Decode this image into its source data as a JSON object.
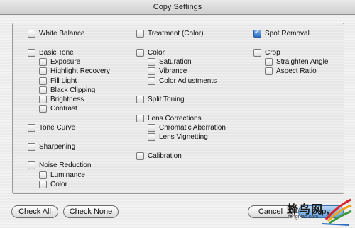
{
  "window": {
    "title": "Copy Settings"
  },
  "columns": [
    [
      {
        "label": "White Balance",
        "checked": false,
        "indent": 0,
        "row": 0
      },
      {
        "label": "Basic Tone",
        "checked": false,
        "indent": 0,
        "row": 2
      },
      {
        "label": "Exposure",
        "checked": false,
        "indent": 1,
        "row": 3
      },
      {
        "label": "Highlight Recovery",
        "checked": false,
        "indent": 1,
        "row": 4
      },
      {
        "label": "Fill Light",
        "checked": false,
        "indent": 1,
        "row": 5
      },
      {
        "label": "Black Clipping",
        "checked": false,
        "indent": 1,
        "row": 6
      },
      {
        "label": "Brightness",
        "checked": false,
        "indent": 1,
        "row": 7
      },
      {
        "label": "Contrast",
        "checked": false,
        "indent": 1,
        "row": 8
      },
      {
        "label": "Tone Curve",
        "checked": false,
        "indent": 0,
        "row": 10
      },
      {
        "label": "Sharpening",
        "checked": false,
        "indent": 0,
        "row": 12
      },
      {
        "label": "Noise Reduction",
        "checked": false,
        "indent": 0,
        "row": 14
      },
      {
        "label": "Luminance",
        "checked": false,
        "indent": 1,
        "row": 15
      },
      {
        "label": "Color",
        "checked": false,
        "indent": 1,
        "row": 16
      }
    ],
    [
      {
        "label": "Treatment (Color)",
        "checked": false,
        "indent": 0,
        "row": 0
      },
      {
        "label": "Color",
        "checked": false,
        "indent": 0,
        "row": 2
      },
      {
        "label": "Saturation",
        "checked": false,
        "indent": 1,
        "row": 3
      },
      {
        "label": "Vibrance",
        "checked": false,
        "indent": 1,
        "row": 4
      },
      {
        "label": "Color Adjustments",
        "checked": false,
        "indent": 1,
        "row": 5
      },
      {
        "label": "Split Toning",
        "checked": false,
        "indent": 0,
        "row": 7
      },
      {
        "label": "Lens Corrections",
        "checked": false,
        "indent": 0,
        "row": 9
      },
      {
        "label": "Chromatic Aberration",
        "checked": false,
        "indent": 1,
        "row": 10
      },
      {
        "label": "Lens Vignetting",
        "checked": false,
        "indent": 1,
        "row": 11
      },
      {
        "label": "Calibration",
        "checked": false,
        "indent": 0,
        "row": 13
      }
    ],
    [
      {
        "label": "Spot Removal",
        "checked": true,
        "indent": 0,
        "row": 0
      },
      {
        "label": "Crop",
        "checked": false,
        "indent": 0,
        "row": 2
      },
      {
        "label": "Straighten Angle",
        "checked": false,
        "indent": 1,
        "row": 3
      },
      {
        "label": "Aspect Ratio",
        "checked": false,
        "indent": 1,
        "row": 4
      }
    ]
  ],
  "buttons": {
    "check_all": "Check All",
    "check_none": "Check None",
    "cancel": "Cancel",
    "copy": "Copy"
  },
  "watermark": {
    "text": "蜂鸟网",
    "url": "fengniao.com"
  }
}
